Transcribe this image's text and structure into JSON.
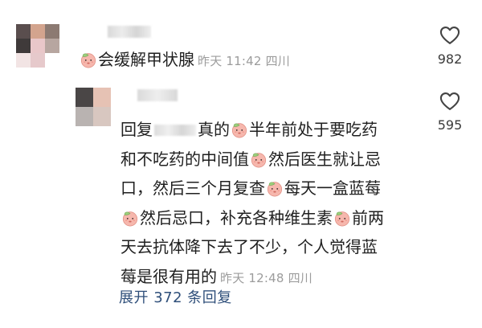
{
  "comment": {
    "text": "会缓解甲状腺",
    "meta": "昨天 11:42 四川",
    "likes": "982",
    "avatar_colors": [
      "#5a4e4e",
      "#d3a48e",
      "#8c7a72",
      "#3f3a3a",
      "#e9c7c9",
      "#b7a6a0",
      "#f2e4e4",
      "#e6c9cb",
      "#ffffff"
    ]
  },
  "reply": {
    "prefix": "回复",
    "mention_tail": "真的",
    "lines": {
      "l1": "半年前处于要吃药",
      "l2a": "和不吃药的中间值",
      "l2b": "然后医生就让忌",
      "l3a": "口，然后三个月复查",
      "l3b": "每天一盒蓝莓",
      "l4a": "然后忌口，补充各种维生素",
      "l4b": "前两",
      "l5": "天去抗体降下去了不少，个人觉得蓝",
      "l6": "莓是很有用的"
    },
    "meta": "昨天 12:48 四川",
    "likes": "595",
    "avatar_colors": [
      "#4a4646",
      "#e6c2b4",
      "#b9b3b1",
      "#d8c7c0"
    ]
  },
  "expand_label": "展开 372 条回复",
  "colors": {
    "text": "#1f1f1f",
    "meta": "#9c9c9c",
    "link": "#2f4f7a"
  },
  "icons": {
    "like": "heart-outline-icon",
    "emoji": "peach-emoji-icon"
  }
}
